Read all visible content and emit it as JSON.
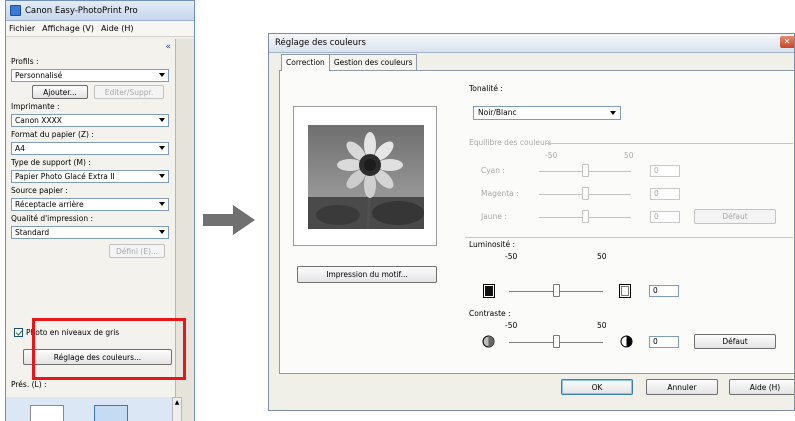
{
  "left_panel": {
    "title": "Canon Easy-PhotoPrint Pro",
    "menu": [
      "Fichier",
      "Affichage (V)",
      "Aide (H)"
    ],
    "profile_label": "Profils :",
    "profile_value": "Personnalisé",
    "add_label": "Ajouter...",
    "edit_delete_label": "Editer/Suppr.",
    "printer_label": "Imprimante :",
    "printer_value": "Canon XXXX",
    "paper_size_label": "Format du papier (Z) :",
    "paper_size_value": "A4",
    "media_type_label": "Type de support (M) :",
    "media_type_value": "Papier Photo Glacé Extra II",
    "paper_source_label": "Source papier :",
    "paper_source_value": "Réceptacle arrière",
    "print_quality_label": "Qualité d'impression :",
    "print_quality_value": "Standard",
    "define_label": "Défini (E)...",
    "grayscale_label": "Photo en niveaux de gris",
    "grayscale_checked": true,
    "color_adjust_label": "Réglage des couleurs...",
    "prev_label": "Prés. (L) :",
    "highlight_color": "#e8161a"
  },
  "dialog": {
    "title": "Réglage des couleurs",
    "tabs": [
      "Correction",
      "Gestion des couleurs"
    ],
    "active_tab": "Correction",
    "print_pattern_label": "Impression du motif...",
    "tone_label": "Tonalité :",
    "tone_value": "Noir/Blanc",
    "color_balance_label": "Equilibre des couleurs",
    "scale_min": "-50",
    "scale_max": "50",
    "cyan_label": "Cyan :",
    "cyan_value": "0",
    "magenta_label": "Magenta :",
    "magenta_value": "0",
    "yellow_label": "Jaune :",
    "yellow_value": "0",
    "defaults_label": "Défaut",
    "brightness_label": "Luminosité :",
    "brightness_value": "0",
    "contrast_label": "Contraste :",
    "contrast_value": "0",
    "ok_label": "OK",
    "cancel_label": "Annuler",
    "help_label": "Aide (H)"
  }
}
